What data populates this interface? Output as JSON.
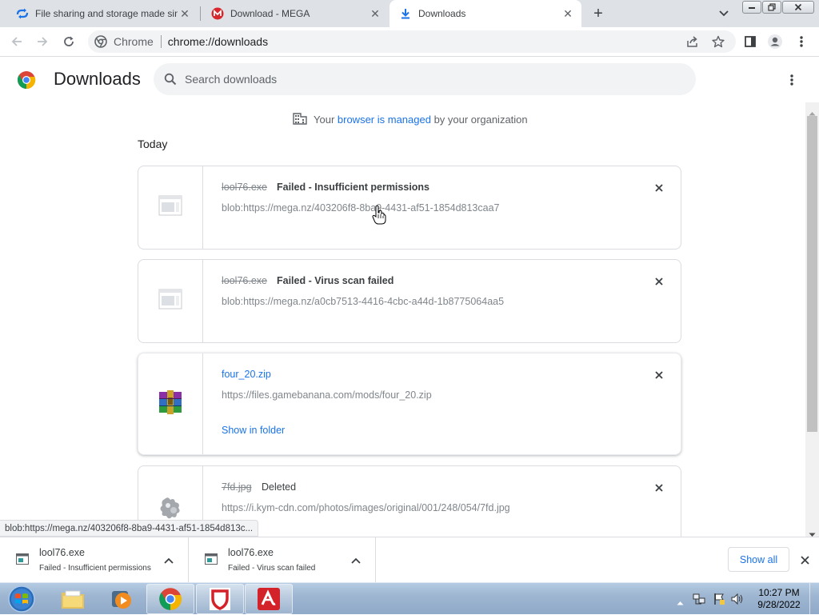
{
  "tabs": [
    {
      "title": "File sharing and storage made simple",
      "active": false,
      "favicon": "cloud-arrows-icon"
    },
    {
      "title": "Download - MEGA",
      "active": false,
      "favicon": "mega-logo-icon"
    },
    {
      "title": "Downloads",
      "active": true,
      "favicon": "download-icon"
    }
  ],
  "omnibox": {
    "site_label": "Chrome",
    "url": "chrome://downloads"
  },
  "page": {
    "title": "Downloads",
    "search_placeholder": "Search downloads",
    "managed": {
      "prefix": "Your ",
      "link": "browser is managed",
      "suffix": " by your organization"
    },
    "section": "Today"
  },
  "downloads": [
    {
      "filename": "lool76.exe",
      "status": "Failed - Insufficient permissions",
      "url": "blob:https://mega.nz/403206f8-8ba9-4431-af51-1854d813caa7",
      "state": "failed"
    },
    {
      "filename": "lool76.exe",
      "status": "Failed - Virus scan failed",
      "url": "blob:https://mega.nz/a0cb7513-4416-4cbc-a44d-1b8775064aa5",
      "state": "failed"
    },
    {
      "filename": "four_20.zip",
      "status": "",
      "url": "https://files.gamebanana.com/mods/four_20.zip",
      "state": "complete",
      "action": "Show in folder"
    },
    {
      "filename": "7fd.jpg",
      "status": "Deleted",
      "url": "https://i.kym-cdn.com/photos/images/original/001/248/054/7fd.jpg",
      "state": "deleted"
    }
  ],
  "status_bubble": "blob:https://mega.nz/403206f8-8ba9-4431-af51-1854d813c...",
  "shelf": {
    "items": [
      {
        "name": "lool76.exe",
        "status": "Failed - Insufficient permissions"
      },
      {
        "name": "lool76.exe",
        "status": "Failed - Virus scan failed"
      }
    ],
    "show_all": "Show all"
  },
  "taskbar": {
    "apps": [
      "start-orb",
      "file-explorer",
      "media-player",
      "chrome",
      "shield-app",
      "avira"
    ],
    "clock_time": "10:27 PM",
    "clock_date": "9/28/2022"
  },
  "colors": {
    "accent": "#1a73e8",
    "tabstrip": "#dee1e6",
    "taskbar": "#9eb6d1"
  }
}
